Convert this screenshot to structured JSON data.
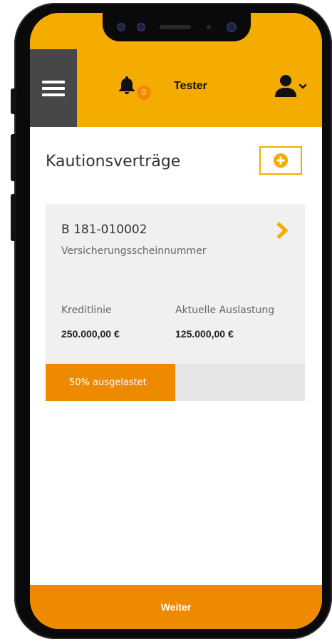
{
  "header": {
    "username": "Tester",
    "notification_count": "0",
    "menu_icon": "hamburger-menu-icon",
    "bell_icon": "bell-icon",
    "user_icon": "user-dropdown-icon"
  },
  "page": {
    "title": "Kautionsverträge",
    "add_icon": "plus-circle-icon"
  },
  "contract": {
    "number": "B 181-010002",
    "number_label": "Versicherungsscheinnummer",
    "credit_line_label": "Kreditlinie",
    "credit_line_value": "250.000,00 €",
    "utilization_label": "Aktuelle Auslastung",
    "utilization_value": "125.000,00 €",
    "progress_text": "50% ausgelastet",
    "progress_fraction": 0.5,
    "chevron_icon": "chevron-right-icon"
  },
  "footer": {
    "button_label": "Weiter"
  },
  "colors": {
    "accent_yellow": "#f4ac00",
    "accent_orange": "#ee8a00",
    "menu_gray": "#474747"
  }
}
